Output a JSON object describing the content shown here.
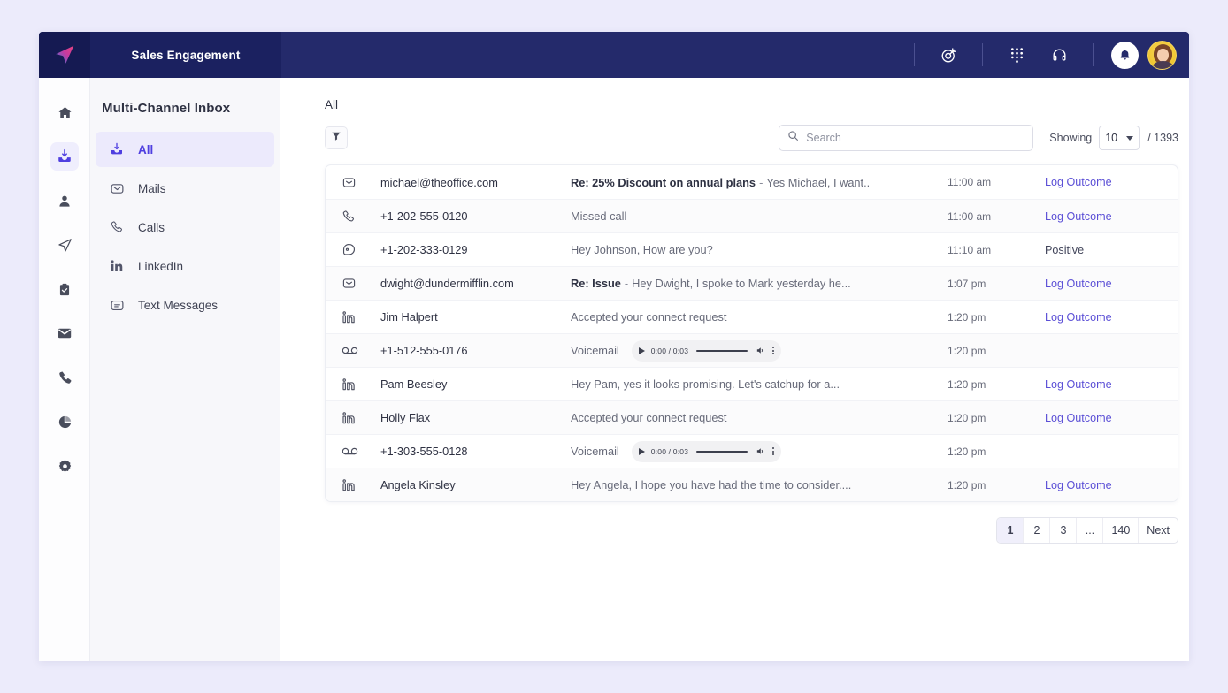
{
  "topbar": {
    "logo_icon": "paper-plane-logo",
    "brand_title": "Sales Engagement",
    "icons": [
      {
        "name": "target-icon",
        "label": "Goals"
      },
      {
        "name": "dialpad-icon",
        "label": "Dialpad"
      },
      {
        "name": "headset-icon",
        "label": "Headset"
      },
      {
        "name": "bell-icon",
        "label": "Notifications"
      }
    ],
    "avatar_label": "User avatar"
  },
  "rail": {
    "items": [
      {
        "name": "home-icon",
        "label": "Home",
        "active": false
      },
      {
        "name": "inbox-icon",
        "label": "Inbox",
        "active": true
      },
      {
        "name": "contacts-icon",
        "label": "Contacts",
        "active": false
      },
      {
        "name": "send-icon",
        "label": "Sequences",
        "active": false
      },
      {
        "name": "tasks-icon",
        "label": "Tasks",
        "active": false
      },
      {
        "name": "mail-icon",
        "label": "Mail",
        "active": false
      },
      {
        "name": "phone-icon",
        "label": "Calls",
        "active": false
      },
      {
        "name": "reports-icon",
        "label": "Reports",
        "active": false
      },
      {
        "name": "settings-icon",
        "label": "Settings",
        "active": false
      }
    ]
  },
  "sidebar": {
    "title": "Multi-Channel Inbox",
    "items": [
      {
        "label": "All",
        "icon": "inbox-icon",
        "active": true
      },
      {
        "label": "Mails",
        "icon": "envelope-icon",
        "active": false
      },
      {
        "label": "Calls",
        "icon": "phone-icon",
        "active": false
      },
      {
        "label": "LinkedIn",
        "icon": "linkedin-icon",
        "active": false
      },
      {
        "label": "Text Messages",
        "icon": "message-icon",
        "active": false
      }
    ]
  },
  "main": {
    "tab_label": "All",
    "filter_icon": "filter-icon",
    "search": {
      "placeholder": "Search",
      "value": "",
      "icon": "search-icon"
    },
    "showing": {
      "label": "Showing",
      "value": "10",
      "total": "/ 1393"
    }
  },
  "list": {
    "rows": [
      {
        "icon": "envelope-icon",
        "from": "michael@theoffice.com",
        "subject": "Re: 25% Discount on annual plans",
        "dash": "-",
        "preview": "Yes Michael, I want..",
        "time": "11:00 am",
        "action": "Log Outcome",
        "action_kind": "link",
        "player": false,
        "shade": false
      },
      {
        "icon": "phone-icon",
        "from": "+1-202-555-0120",
        "subject": "",
        "dash": "",
        "preview": "Missed call",
        "time": "11:00 am",
        "action": "Log Outcome",
        "action_kind": "link",
        "player": false,
        "shade": true
      },
      {
        "icon": "message-icon",
        "from": "+1-202-333-0129",
        "subject": "",
        "dash": "",
        "preview": "Hey Johnson, How are you?",
        "time": "11:10 am",
        "action": "Positive",
        "action_kind": "plain",
        "player": false,
        "shade": false
      },
      {
        "icon": "envelope-icon",
        "from": "dwight@dundermifflin.com",
        "subject": "Re: Issue",
        "dash": "-",
        "preview": "Hey Dwight, I spoke to Mark yesterday he...",
        "time": "1:07 pm",
        "action": "Log Outcome",
        "action_kind": "link",
        "player": false,
        "shade": true
      },
      {
        "icon": "linkedin-icon",
        "from": "Jim Halpert",
        "subject": "",
        "dash": "",
        "preview": "Accepted your connect request",
        "time": "1:20 pm",
        "action": "Log Outcome",
        "action_kind": "link",
        "player": false,
        "shade": false
      },
      {
        "icon": "voicemail-icon",
        "from": "+1-512-555-0176",
        "subject": "",
        "dash": "",
        "preview": "Voicemail",
        "time": "1:20 pm",
        "action": "",
        "action_kind": "plain",
        "player": true,
        "player_time": "0:00 / 0:03",
        "shade": true
      },
      {
        "icon": "linkedin-icon",
        "from": "Pam Beesley",
        "subject": "",
        "dash": "",
        "preview": "Hey Pam, yes it looks promising. Let's catchup for a...",
        "time": "1:20 pm",
        "action": "Log Outcome",
        "action_kind": "link",
        "player": false,
        "shade": false
      },
      {
        "icon": "linkedin-icon",
        "from": "Holly Flax",
        "subject": "",
        "dash": "",
        "preview": "Accepted your connect request",
        "time": "1:20 pm",
        "action": "Log Outcome",
        "action_kind": "link",
        "player": false,
        "shade": true
      },
      {
        "icon": "voicemail-icon",
        "from": "+1-303-555-0128",
        "subject": "",
        "dash": "",
        "preview": "Voicemail",
        "time": "1:20 pm",
        "action": "",
        "action_kind": "plain",
        "player": true,
        "player_time": "0:00 / 0:03",
        "shade": false
      },
      {
        "icon": "linkedin-icon",
        "from": "Angela Kinsley",
        "subject": "",
        "dash": "",
        "preview": "Hey Angela, I hope you have had the time to consider....",
        "time": "1:20 pm",
        "action": "Log Outcome",
        "action_kind": "link",
        "player": false,
        "shade": true
      }
    ]
  },
  "pagination": {
    "pages": [
      {
        "label": "1",
        "active": true
      },
      {
        "label": "2",
        "active": false
      },
      {
        "label": "3",
        "active": false
      },
      {
        "label": "...",
        "active": false
      },
      {
        "label": "140",
        "active": false
      },
      {
        "label": "Next",
        "active": false
      }
    ]
  },
  "colors": {
    "topbar": "#242a6b",
    "logo_block": "#151a52",
    "accent_purple": "#4f3fe0",
    "link_purple": "#5b4fd6",
    "page_bg": "#ecebfb",
    "sidebar_bg": "#f7f7fa",
    "active_item_bg": "#eceafc"
  }
}
